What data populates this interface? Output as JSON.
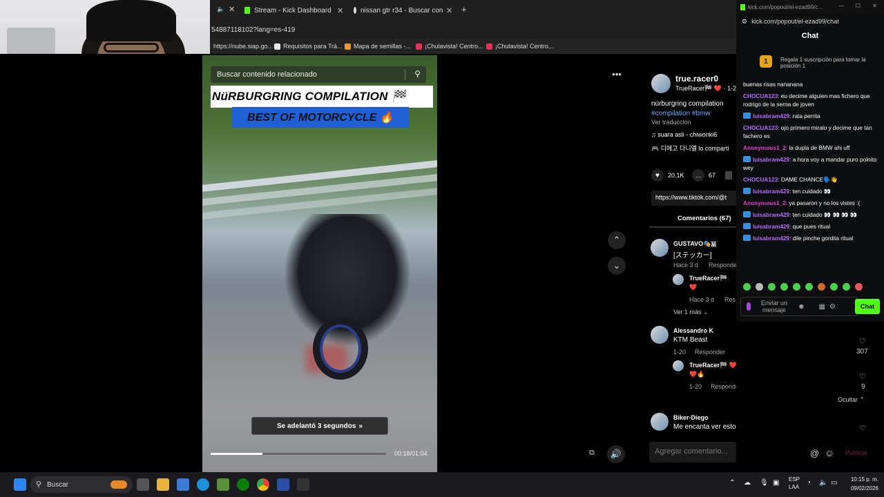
{
  "browser": {
    "tabs": [
      {
        "label": "Stream - Kick Dashboard",
        "color": "#53fc18"
      },
      {
        "label": "nissan gtr r34 - Buscar con Goo",
        "color": "#ffffff"
      }
    ],
    "url": "54887118102?lang=es-419",
    "bookmarks": [
      {
        "label": "https://nube.siap.go...",
        "color": "#4aa3ff"
      },
      {
        "label": "Requisitos para Trá...",
        "color": "#e8e8e8"
      },
      {
        "label": "Mapa de semillas -...",
        "color": "#e89a3a"
      },
      {
        "label": "¡Chulavista! Centro...",
        "color": "#e0335a"
      },
      {
        "label": "¡Chulavista! Centro...",
        "color": "#e0335a"
      }
    ]
  },
  "video": {
    "search_placeholder": "Buscar contenido relacionado",
    "title_line1": "NüRBURGRING COMPILATION 🏁",
    "title_line2": "BEST OF MOTORCYCLE 🔥",
    "seek_toast": "Se adelantó 3 segundos",
    "timecode": "00:18/01:04",
    "progress": 0.295
  },
  "post": {
    "author": "true.racer0",
    "author_sub": "TrueRacer🏁 ❤️ · 1-2",
    "caption": "nürburgring compilation",
    "hashtags": "#compilation #bmw",
    "translate": "Ver traducción",
    "music": "♫  suara asli - chiwonki6",
    "korean": "🎮 디에고 다니엘 lo comparti",
    "likes": "20.1K",
    "comments_count": "67",
    "link": "https://www.tiktok.com/@t",
    "comments_tab": "Comentarios (67)",
    "comments": [
      {
        "user": "GUSTAVO🎭🇲",
        "text": "[ステッカー]",
        "meta": "Hace 3 d",
        "reply": "Responder"
      },
      {
        "user": "TrueRacer🏁",
        "text": "❤️",
        "meta": "Hace 3 d",
        "reply": "Res"
      },
      {
        "user": "Alessandro K",
        "text": "KTM Beast",
        "meta": "1-20",
        "reply": "Responder",
        "likes": "307"
      },
      {
        "user": "TrueRacer🏁 ❤️ · Creador",
        "text": "❤️🔥",
        "meta": "1-20",
        "reply": "Responder",
        "likes": "9"
      },
      {
        "user": "Biker-Diego",
        "text": "Me encanta ver estos videos donde no hay rivalidad",
        "meta": "",
        "reply": ""
      }
    ],
    "more_replies": "Ver 1 más",
    "hide": "Ocultar",
    "add_comment": "Agregar comentario...",
    "publish": "Publicar"
  },
  "chat": {
    "window_title": "kick.com/popout/el-ezad99/c...",
    "url": "kick.com/popout/el-ezad99/chat",
    "heading": "Chat",
    "banner_rank": "1",
    "banner": "Regala 1 suscripción para tomar la posición 1",
    "messages": [
      {
        "user": "",
        "text": "buenas risas nananana",
        "color": "#ffffff",
        "badge": false
      },
      {
        "user": "CHOCUA123",
        "text": ": eu decime alguien mas fichero que rodrigo de la serna de joven",
        "color": "#b86cff",
        "badge": false
      },
      {
        "user": "luisabram429",
        "text": ": rata perrita",
        "color": "#b86cff",
        "badge": true
      },
      {
        "user": "CHOCUA123",
        "text": ": ojo primero miralo y decime que tan fachero es",
        "color": "#b86cff",
        "badge": false
      },
      {
        "user": "Anonymous1_2",
        "text": ": la dupla de BMW ahi uff",
        "color": "#e23fd0",
        "badge": false
      },
      {
        "user": "luisabram429",
        "text": ": a hora voy a mandar puro polnito wey",
        "color": "#b86cff",
        "badge": true
      },
      {
        "user": "CHOCUA123",
        "text": ": DAME CHANCE🗣️👋",
        "color": "#b86cff",
        "badge": false
      },
      {
        "user": "luisabram429",
        "text": ": ten cuidado 👀",
        "color": "#b86cff",
        "badge": true
      },
      {
        "user": "Anonymous1_2",
        "text": ": ya pasaron y no los vistes :(",
        "color": "#e23fd0",
        "badge": false
      },
      {
        "user": "luisabram429",
        "text": ": ten cuidado 👀 👀 👀 👀",
        "color": "#b86cff",
        "badge": true
      },
      {
        "user": "luisabram429",
        "text": ": que pues ritual",
        "color": "#b86cff",
        "badge": true
      },
      {
        "user": "luisabram429",
        "text": ": dile pinche gordita ritual",
        "color": "#b86cff",
        "badge": true
      }
    ],
    "input_placeholder": "Enviar un mensaje",
    "send": "Chat",
    "accent": "#53fc18"
  },
  "taskbar": {
    "search": "Buscar",
    "lang_top": "ESP",
    "lang_bottom": "LAA",
    "time": "10:15 p. m.",
    "date": "09/02/2026"
  }
}
